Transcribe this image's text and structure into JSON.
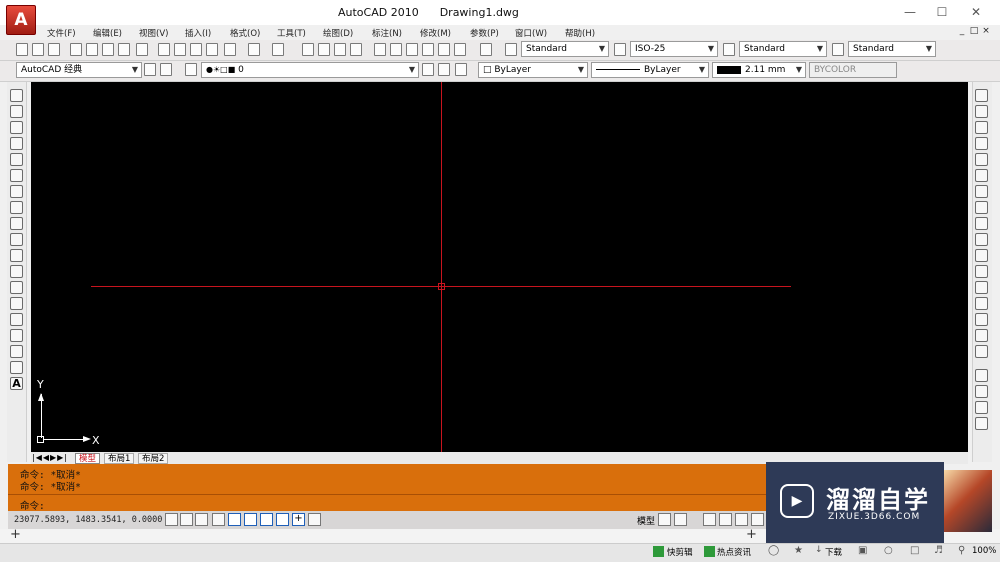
{
  "window": {
    "title": "AutoCAD 2010",
    "document": "Drawing1.dwg",
    "minimize_label": "—",
    "maximize_label": "☐",
    "close_label": "✕"
  },
  "menubar": {
    "items": [
      "文件(F)",
      "编辑(E)",
      "视图(V)",
      "插入(I)",
      "格式(O)",
      "工具(T)",
      "绘图(D)",
      "标注(N)",
      "修改(M)",
      "参数(P)",
      "窗口(W)",
      "帮助(H)"
    ]
  },
  "toolbar1": {
    "text_style": "Standard",
    "dim_style": "ISO-25",
    "table_style": "Standard",
    "multileader_style": "Standard"
  },
  "toolbar2": {
    "workspace": "AutoCAD 经典",
    "layer": "0",
    "color": "ByLayer",
    "linetype": "ByLayer",
    "lineweight": "2.11 mm",
    "plotstyle": "BYCOLOR"
  },
  "ucs": {
    "y_label": "Y",
    "x_label": "X"
  },
  "layout_tabs": {
    "model": "模型",
    "layout1": "布局1",
    "layout2": "布局2"
  },
  "command": {
    "line1": "命令: *取消*",
    "line2": "命令: *取消*",
    "prompt": "命令:"
  },
  "status": {
    "coords": "23077.5893, 1483.3541, 0.0000",
    "model_label": "模型"
  },
  "taskbar": {
    "item1": "快剪辑",
    "item2": "热点资讯",
    "item3": "下载",
    "zoom": "100%"
  },
  "watermark": {
    "brand": "溜溜自学",
    "url": "ZIXUE.3D66.COM"
  },
  "colors": {
    "drawing_bg": "#000000",
    "crosshair": "#c8141e",
    "command_bg": "#d96f0c",
    "active_tab": "#c8141e"
  }
}
